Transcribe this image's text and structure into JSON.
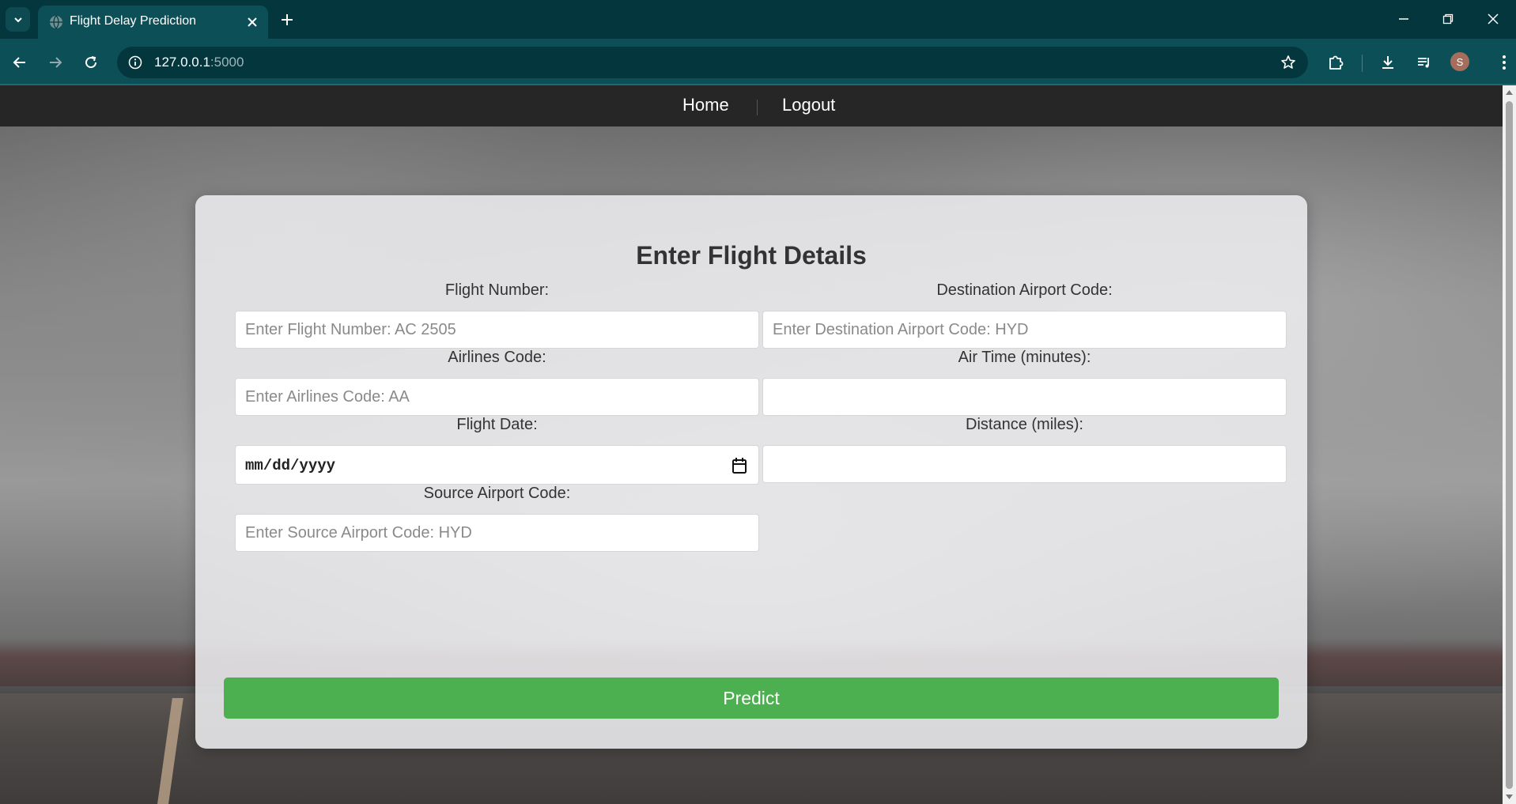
{
  "browser": {
    "tab_title": "Flight Delay Prediction",
    "url_host": "127.0.0.1",
    "url_port": ":5000",
    "profile_initial": "S"
  },
  "navbar": {
    "links": [
      "Home",
      "Logout"
    ]
  },
  "form": {
    "title": "Enter Flight Details",
    "fields": {
      "flight_number": {
        "label": "Flight Number:",
        "placeholder": "Enter Flight Number: AC 2505",
        "value": ""
      },
      "airlines_code": {
        "label": "Airlines Code:",
        "placeholder": "Enter Airlines Code: AA",
        "value": ""
      },
      "flight_date": {
        "label": "Flight Date:",
        "value": "mm/dd/yyyy"
      },
      "source_airport": {
        "label": "Source Airport Code:",
        "placeholder": "Enter Source Airport Code: HYD",
        "value": ""
      },
      "destination_airport": {
        "label": "Destination Airport Code:",
        "placeholder": "Enter Destination Airport Code: HYD",
        "value": ""
      },
      "air_time": {
        "label": "Air Time (minutes):",
        "placeholder": "",
        "value": ""
      },
      "distance": {
        "label": "Distance (miles):",
        "placeholder": "",
        "value": ""
      }
    },
    "submit_label": "Predict"
  },
  "colors": {
    "accent": "#4caf50",
    "navbar": "#262626",
    "chrome": "#03363d"
  }
}
